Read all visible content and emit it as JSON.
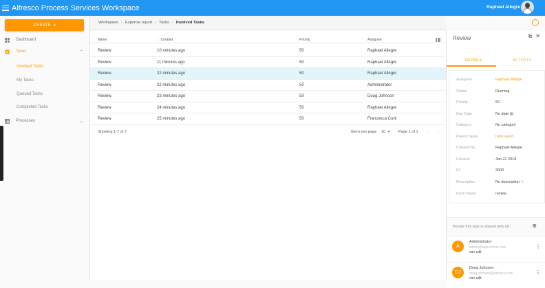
{
  "app": {
    "title": "Alfresco Process Services Workspace",
    "user_name": "Raphael Allegre"
  },
  "sidebar": {
    "create_label": "CREATE",
    "items": [
      {
        "label": "Dashboard"
      },
      {
        "label": "Tasks"
      },
      {
        "label": "Processes"
      }
    ],
    "task_filters": [
      "Involved Tasks",
      "My Tasks",
      "Queued Tasks",
      "Completed Tasks"
    ]
  },
  "breadcrumb": [
    "Workspace",
    "Expense report",
    "Tasks",
    "Involved Tasks"
  ],
  "table": {
    "columns": [
      "Name",
      "Created",
      "Priority",
      "Assignee"
    ],
    "rows": [
      {
        "name": "Review",
        "created": "10 minutes ago",
        "priority": "50",
        "assignee": "Raphael Allegre"
      },
      {
        "name": "Review",
        "created": "11 minutes ago",
        "priority": "50",
        "assignee": "Raphael Allegre"
      },
      {
        "name": "Review",
        "created": "22 minutes ago",
        "priority": "50",
        "assignee": "Raphael Allegre"
      },
      {
        "name": "Review",
        "created": "22 minutes ago",
        "priority": "50",
        "assignee": "Administrator"
      },
      {
        "name": "Review",
        "created": "23 minutes ago",
        "priority": "50",
        "assignee": "Doug Johnson"
      },
      {
        "name": "Review",
        "created": "24 minutes ago",
        "priority": "50",
        "assignee": "Raphael Allegre"
      },
      {
        "name": "Review",
        "created": "25 minutes ago",
        "priority": "50",
        "assignee": "Francesca Corti"
      }
    ],
    "showing": "Showing 1-7 of 7",
    "items_per_page_label": "Items per page",
    "items_per_page": "10",
    "page_label": "Page 1 of 1"
  },
  "panel": {
    "title": "Review",
    "tabs": [
      "DETAILS",
      "ACTIVITY"
    ],
    "details": [
      {
        "label": "Assignee",
        "value": "Raphael Allegre"
      },
      {
        "label": "Status",
        "value": "Running"
      },
      {
        "label": "Priority",
        "value": "50"
      },
      {
        "label": "Due Date",
        "value": "No date"
      },
      {
        "label": "Category",
        "value": "No category"
      },
      {
        "label": "Parent name",
        "value": "hello world"
      },
      {
        "label": "Created By",
        "value": "Raphael Allegre"
      },
      {
        "label": "Created",
        "value": "Jan 22 2018"
      },
      {
        "label": "ID",
        "value": "2600"
      },
      {
        "label": "Description",
        "value": "No description"
      },
      {
        "label": "Form Name",
        "value": "review"
      }
    ],
    "people_header": "People this task is shared with (3)",
    "people": [
      {
        "initials": "A",
        "name": "Administrator",
        "email": "admin@app.activiti.com",
        "permission": "can edit"
      },
      {
        "initials": "DJ",
        "name": "Doug Johnson",
        "email": "doug.johnson@alfresco.com",
        "permission": "can edit"
      }
    ]
  },
  "colors": {
    "topbar": "#2196f3",
    "accent": "#ff9800",
    "selected_row": "#e3f4fb"
  }
}
